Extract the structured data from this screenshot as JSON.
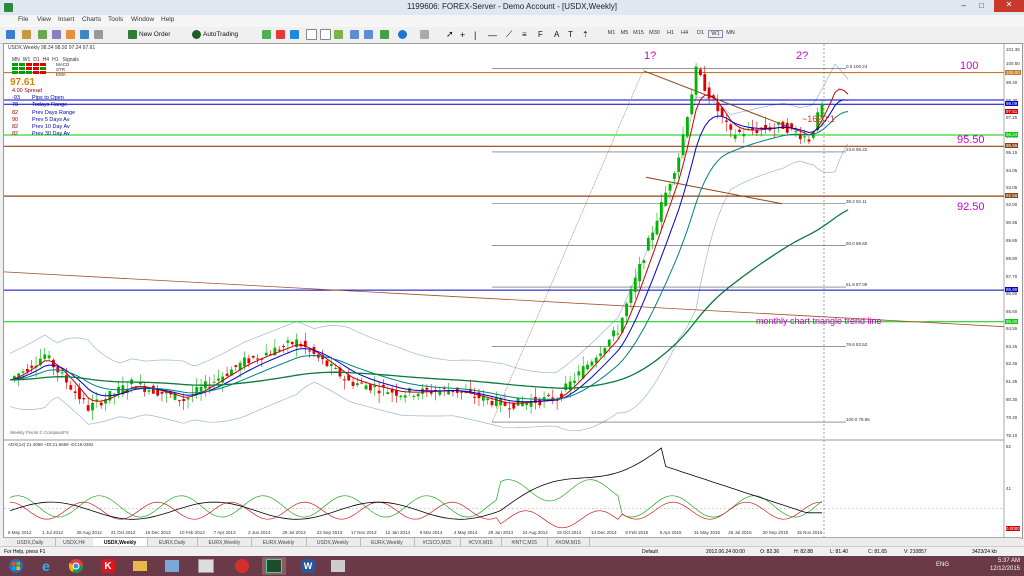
{
  "window": {
    "title": "1199606: FOREX-Server - Demo Account - [USDX,Weekly]",
    "min": "–",
    "max": "□",
    "close": "✕"
  },
  "menu": [
    "File",
    "View",
    "Insert",
    "Charts",
    "Tools",
    "Window",
    "Help"
  ],
  "toolbar": {
    "new_order": "New Order",
    "autotrading": "AutoTrading",
    "timeframes": [
      "M1",
      "M5",
      "M15",
      "M30",
      "H1",
      "H4",
      "D1",
      "W1",
      "MN"
    ]
  },
  "chart": {
    "symbol_header": "USDX,Weekly  98.34 98.92 97.24 97.61",
    "signals_label": "Signals",
    "signals_tf": [
      "MN",
      "W1",
      "D1",
      "H4",
      "H1"
    ],
    "signal_names": [
      "MACD",
      "STR",
      "EMA"
    ],
    "price_big": "97.61",
    "spread_text": "4.00 Spread",
    "pips_to_open": "Pips to Open",
    "info_rows": [
      {
        "value": "-93",
        "label": "Pips to Open"
      },
      {
        "value": "78",
        "label": "Todays Range"
      },
      {
        "value": "82",
        "label": "Prev Days Range"
      },
      {
        "value": "90",
        "label": "Prev 5 Days Av"
      },
      {
        "value": "82",
        "label": "Prev 10 Day Av"
      },
      {
        "value": "82",
        "label": "Prev 30 Day Av"
      }
    ],
    "annotations": {
      "one": "1?",
      "two": "2?",
      "level_100": "100",
      "level_9550": "95.50",
      "level_9250": "92.50",
      "pips": "~1620:1",
      "triangle": "monthly chart triangle trend line"
    },
    "fib_labels": [
      "0.0  100.24",
      "23.6  95.22",
      "38.2  92.11",
      "50.0  89.60",
      "61.8  87.09",
      "78.6  83.52",
      "100.0  78.96"
    ],
    "price_axis": [
      "101.35",
      "100.50",
      "99.40",
      "98.30",
      "97.25",
      "96.15",
      "95.15",
      "94.05",
      "93.05",
      "92.00",
      "90.95",
      "89.85",
      "88.80",
      "87.70",
      "86.65",
      "85.60",
      "84.55",
      "83.45",
      "82.45",
      "81.35",
      "80.30",
      "79.20",
      "78.10"
    ],
    "price_tags": [
      "100.00",
      "98.09",
      "97.61",
      "96.24",
      "95.56",
      "92.56",
      "86.90",
      "85.00"
    ],
    "date_axis": [
      "6 May 2012",
      "1 Jul 2012",
      "26 Aug 2012",
      "21 Oct 2012",
      "16 Dec 2012",
      "10 Feb 2013",
      "7 Apr 2013",
      "2 Jun 2013",
      "28 Jul 2013",
      "22 Sep 2013",
      "17 Nov 2013",
      "12 Jan 2014",
      "9 Mar 2014",
      "4 May 2014",
      "29 Jun 2014",
      "24 Aug 2014",
      "19 Oct 2014",
      "14 Dec 2014",
      "8 Feb 2015",
      "5 Apr 2015",
      "31 May 2015",
      "26 Jul 2015",
      "20 Sep 2015",
      "15 Nov 2015"
    ],
    "watermark": "Weekly Pivots © CompassFX",
    "adx_header": "ADX(14) 21.4058 +DI:21.6669 -DI:19.0282",
    "adx_axis": [
      "82",
      "41",
      "0.0000"
    ]
  },
  "tabs": [
    "USDX,Daily",
    "USDX,H4",
    "USDX,Weekly",
    "EURX,Daily",
    "EURX,Weekly",
    "EURX,Weekly",
    "USDX,Weekly",
    "EURX,Weekly",
    "#CSCO,M15",
    "#CVX,M15",
    "#INTC,M15",
    "#XOM,M15"
  ],
  "active_tab_index": 2,
  "status": {
    "help": "For Help, press F1",
    "profile": "Default",
    "datetime": "2012.06.24 00:00",
    "open": "O: 82.36",
    "high": "H: 82.88",
    "low": "L: 81.40",
    "close": "C: 81.65",
    "volume": "V: 210857",
    "traffic": "3423/24 kb"
  },
  "taskbar": {
    "lang": "ENG",
    "time": "5:37 AM",
    "date": "12/12/2015"
  },
  "colors": {
    "bull": "#00b400",
    "bear": "#e00000",
    "magenta": "#cc00cc",
    "brown": "#8b4513",
    "blue_line": "#0000cc",
    "green_line": "#00aa00"
  }
}
